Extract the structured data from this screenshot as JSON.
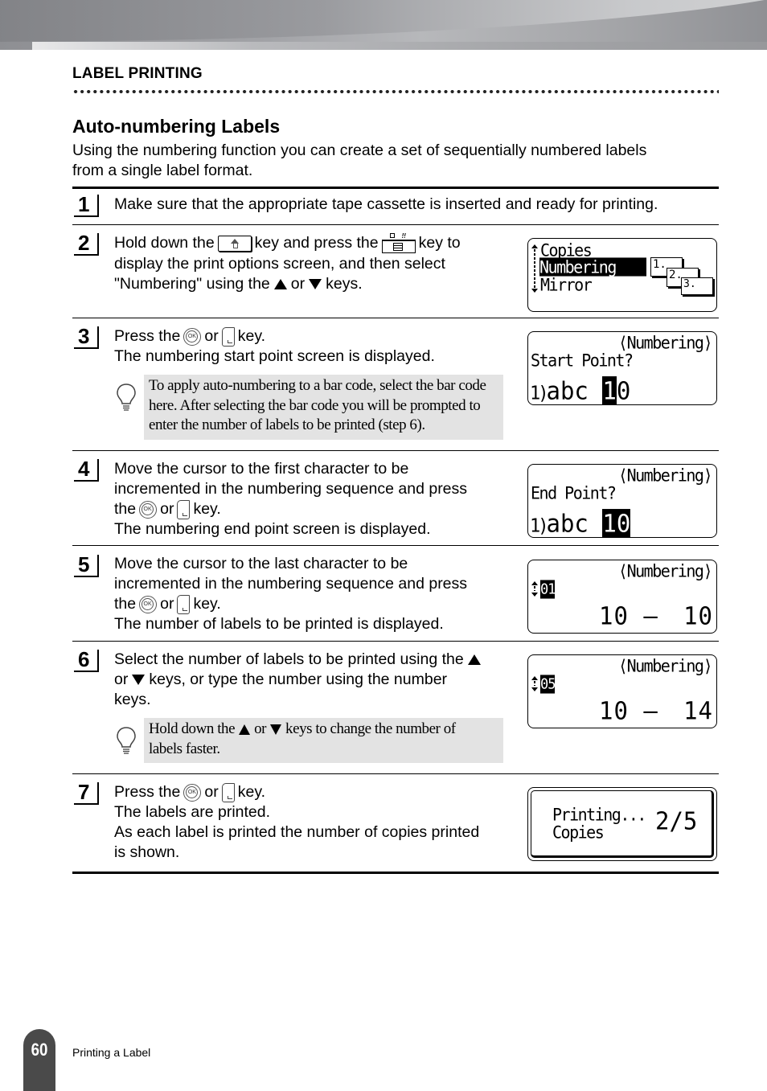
{
  "header": {
    "section_label": "LABEL PRINTING"
  },
  "heading": "Auto-numbering Labels",
  "intro": {
    "line1": "Using the numbering function you can create a set of sequentially numbered labels",
    "line2": "from a single label format."
  },
  "steps": [
    {
      "number": "1",
      "text": "Make sure that the appropriate tape cassette is inserted and ready for printing."
    },
    {
      "number": "2",
      "parts": {
        "a": "Hold down the",
        "b": "key and press the",
        "c": "key to",
        "d": "display the print options screen, and then select",
        "e": "\"Numbering\" using the",
        "f": "or",
        "g": "keys."
      },
      "keys": [
        "shift-key-icon",
        "print-key-icon",
        "up-arrow-key-icon",
        "down-arrow-key-icon"
      ],
      "lcd": {
        "menu_items": [
          "Copies",
          "Numbering",
          "Mirror"
        ],
        "selected": "Numbering",
        "icon_labels": [
          "1.",
          "2.",
          "3."
        ]
      }
    },
    {
      "number": "3",
      "parts": {
        "a": "Press the",
        "b": "or",
        "c": "key.",
        "d": "The numbering start point screen is displayed."
      },
      "keys": [
        "ok-key-icon",
        "enter-key-icon"
      ],
      "tip": {
        "line1": "To apply auto-numbering to a bar code, select the bar code",
        "line2": "here. After selecting the bar code you will be prompted to",
        "line3": "enter the number of labels to be printed (step 6)."
      },
      "lcd": {
        "title": "⟨Numbering⟩",
        "prompt": "Start Point?",
        "line_marker": "1)",
        "text": "abc",
        "cursor_char": "1",
        "rest": "0"
      }
    },
    {
      "number": "4",
      "parts": {
        "a": "Move the cursor to the first character to be",
        "b": "incremented in the numbering sequence and press",
        "c": "the",
        "d": "or",
        "e": "key.",
        "f": "The numbering end point screen is displayed."
      },
      "keys": [
        "ok-key-icon",
        "enter-key-icon"
      ],
      "lcd": {
        "title": "⟨Numbering⟩",
        "prompt": "End Point?",
        "line_marker": "1)",
        "text": "abc",
        "selected": "10"
      }
    },
    {
      "number": "5",
      "parts": {
        "a": "Move the cursor to the last character to be",
        "b": "incremented in the numbering sequence and press",
        "c": "the",
        "d": "or",
        "e": "key.",
        "f": "The number of labels to be printed is displayed."
      },
      "keys": [
        "ok-key-icon",
        "enter-key-icon"
      ],
      "lcd": {
        "title": "⟨Numbering⟩",
        "count": "01",
        "range_start": "10",
        "range_dash": "–",
        "range_end": "10"
      }
    },
    {
      "number": "6",
      "parts": {
        "a": "Select the number of labels to be printed using the",
        "b": "or",
        "c": "keys, or type the number using the number",
        "d": "keys."
      },
      "keys": [
        "up-arrow-key-icon",
        "down-arrow-key-icon"
      ],
      "tip": {
        "a": "Hold down the",
        "b": "or",
        "c": "keys to change the number of",
        "d": "labels faster."
      },
      "lcd": {
        "title": "⟨Numbering⟩",
        "count": "05",
        "range_start": "10",
        "range_dash": "–",
        "range_end": "14"
      }
    },
    {
      "number": "7",
      "parts": {
        "a": "Press the",
        "b": "or",
        "c": "key.",
        "d": "The labels are printed.",
        "e": "As each label is printed the number of copies printed",
        "f": "is shown."
      },
      "keys": [
        "ok-key-icon",
        "enter-key-icon"
      ],
      "lcd": {
        "line1": "Printing...",
        "line2": "Copies",
        "progress": "2/5"
      }
    }
  ],
  "footer": {
    "page_number": "60",
    "chapter": "Printing a Label"
  }
}
